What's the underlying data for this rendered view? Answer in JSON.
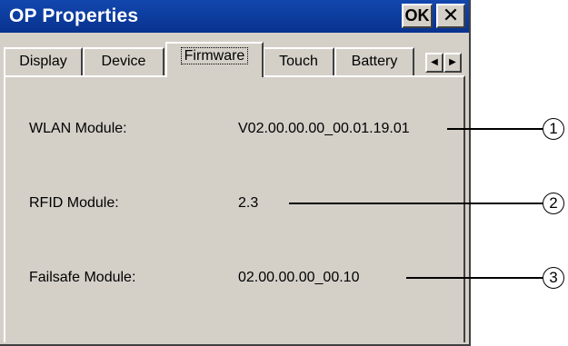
{
  "window": {
    "title": "OP Properties",
    "ok_label": "OK",
    "close_label": "✕"
  },
  "tabs": [
    {
      "label": "Display",
      "active": false
    },
    {
      "label": "Device",
      "active": false
    },
    {
      "label": "Firmware",
      "active": true
    },
    {
      "label": "Touch",
      "active": false
    },
    {
      "label": "Battery",
      "active": false
    }
  ],
  "tab_scroll": {
    "left_icon": "◀",
    "right_icon": "▶"
  },
  "firmware": {
    "rows": [
      {
        "label": "WLAN Module:",
        "value": "V02.00.00.00_00.01.19.01",
        "callout": "1"
      },
      {
        "label": "RFID Module:",
        "value": "2.3",
        "callout": "2"
      },
      {
        "label": "Failsafe Module:",
        "value": "02.00.00.00_00.10",
        "callout": "3"
      }
    ]
  }
}
